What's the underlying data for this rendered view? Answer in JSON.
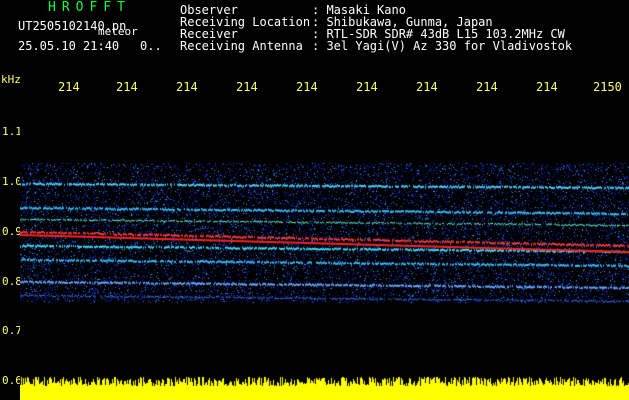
{
  "header": {
    "brand": "HROFFT",
    "filename": "UT2505102140.pn",
    "meteor_tag": "meteor",
    "datetime": "25.05.10 21:40",
    "count": "0..",
    "fields": [
      {
        "label": "Observer",
        "value": ": Masaki Kano"
      },
      {
        "label": "Receiving Location",
        "value": ": Shibukawa, Gunma, Japan"
      },
      {
        "label": "Receiver",
        "value": ": RTL-SDR SDR# 43dB L15 103.2MHz CW"
      },
      {
        "label": "Receiving Antenna",
        "value": ": 3el Yagi(V) Az 330 for Vladivostok"
      }
    ]
  },
  "axis": {
    "y_unit": "kHz",
    "y_ticks": [
      "1.1",
      "1.0",
      "0.9",
      "0.8",
      "0.7",
      "0.6"
    ],
    "x_ticks": [
      "214",
      "214",
      "214",
      "214",
      "214",
      "214",
      "214",
      "214",
      "214",
      "2150"
    ]
  },
  "colors": {
    "brand": "#00ff3c",
    "header_text": "#ffffff",
    "tick_text": "#ffff66",
    "floor": "#ffff00"
  }
}
